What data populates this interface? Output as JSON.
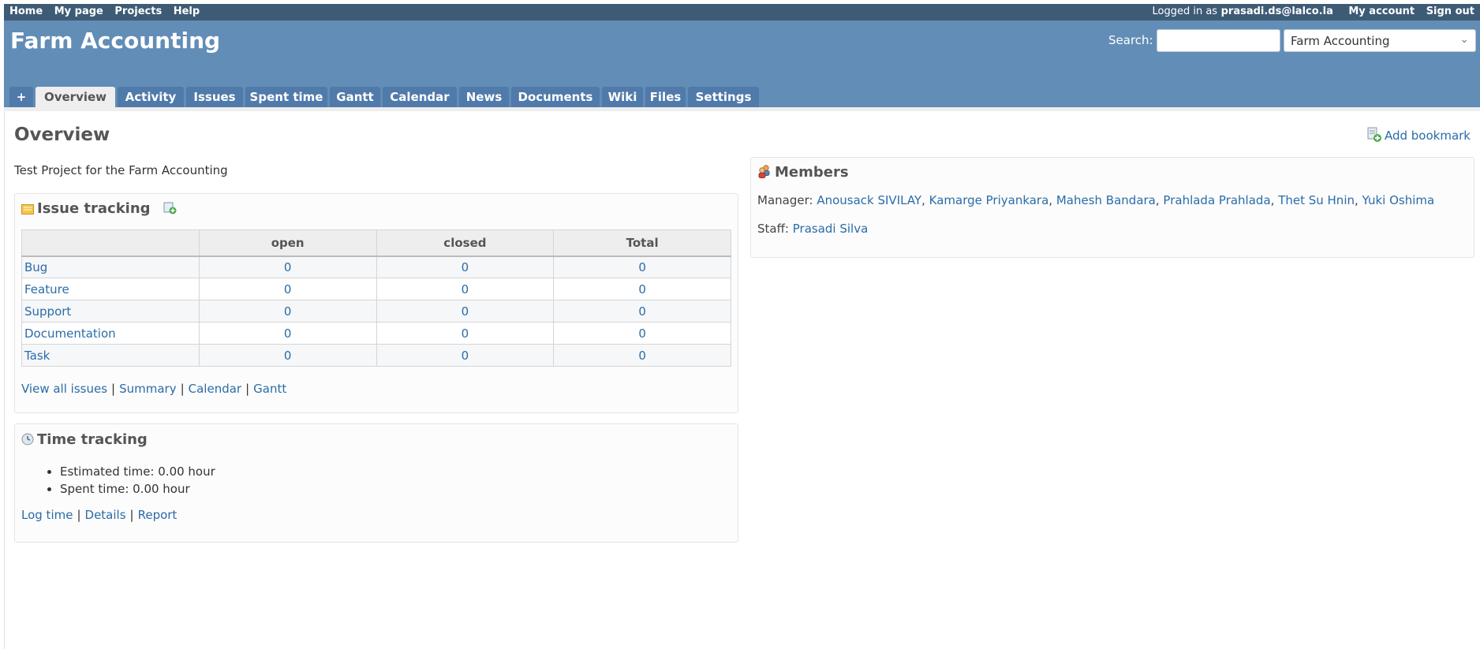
{
  "top_menu": {
    "left": [
      "Home",
      "My page",
      "Projects",
      "Help"
    ],
    "logged_in_label": "Logged in as",
    "user": "prasadi.ds@lalco.la",
    "my_account": "My account",
    "sign_out": "Sign out"
  },
  "header": {
    "project_title": "Farm Accounting",
    "search_label": "Search:",
    "search_value": "",
    "project_jump_value": "Farm Accounting"
  },
  "tabs": [
    "+",
    "Overview",
    "Activity",
    "Issues",
    "Spent time",
    "Gantt",
    "Calendar",
    "News",
    "Documents",
    "Wiki",
    "Files",
    "Settings"
  ],
  "selected_tab": "Overview",
  "page": {
    "title": "Overview",
    "add_bookmark": "Add bookmark",
    "description": "Test Project for the Farm Accounting"
  },
  "issue_tracking": {
    "title": "Issue tracking",
    "columns": [
      "",
      "open",
      "closed",
      "Total"
    ],
    "rows": [
      {
        "tracker": "Bug",
        "open": "0",
        "closed": "0",
        "total": "0"
      },
      {
        "tracker": "Feature",
        "open": "0",
        "closed": "0",
        "total": "0"
      },
      {
        "tracker": "Support",
        "open": "0",
        "closed": "0",
        "total": "0"
      },
      {
        "tracker": "Documentation",
        "open": "0",
        "closed": "0",
        "total": "0"
      },
      {
        "tracker": "Task",
        "open": "0",
        "closed": "0",
        "total": "0"
      }
    ],
    "links": [
      "View all issues",
      "Summary",
      "Calendar",
      "Gantt"
    ],
    "separator": "|"
  },
  "time_tracking": {
    "title": "Time tracking",
    "items": [
      "Estimated time: 0.00 hour",
      "Spent time: 0.00 hour"
    ],
    "links": [
      "Log time",
      "Details",
      "Report"
    ]
  },
  "members": {
    "title": "Members",
    "manager_label": "Manager:",
    "managers": [
      "Anousack SIVILAY",
      "Kamarge Priyankara",
      "Mahesh Bandara",
      "Prahlada Prahlada",
      "Thet Su Hnin",
      "Yuki Oshima"
    ],
    "staff_label": "Staff:",
    "staff": [
      "Prasadi Silva"
    ]
  },
  "colors": {
    "top_menu_bg": "#3e5b76",
    "header_bg": "#628db6",
    "tab_bg": "#507aaa",
    "link": "#2a6ca8"
  }
}
